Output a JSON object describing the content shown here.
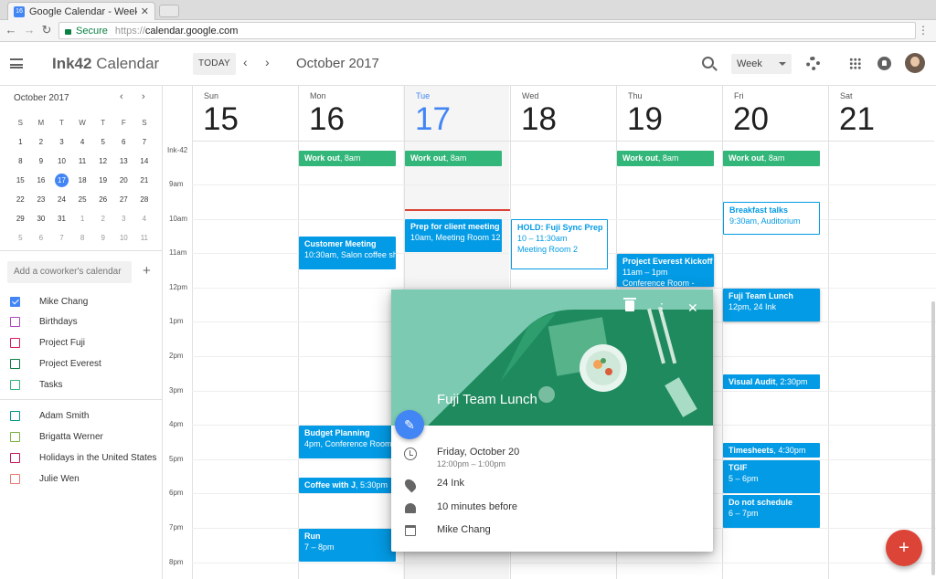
{
  "browser": {
    "tab_title": "Google Calendar - Week of Oc",
    "tab_favicon": "16",
    "secure_label": "Secure",
    "url_scheme": "https://",
    "url_host": "calendar.google.com"
  },
  "header": {
    "app_name_bold": "Ink42",
    "app_name_rest": " Calendar",
    "today_label": "TODAY",
    "month_title": "October 2017",
    "view_label": "Week"
  },
  "mini_calendar": {
    "title": "October 2017",
    "weekdays": [
      "S",
      "M",
      "T",
      "W",
      "T",
      "F",
      "S"
    ],
    "weeks": [
      [
        "1",
        "2",
        "3",
        "4",
        "5",
        "6",
        "7"
      ],
      [
        "8",
        "9",
        "10",
        "11",
        "12",
        "13",
        "14"
      ],
      [
        "15",
        "16",
        "17",
        "18",
        "19",
        "20",
        "21"
      ],
      [
        "22",
        "23",
        "24",
        "25",
        "26",
        "27",
        "28"
      ],
      [
        "29",
        "30",
        "31",
        "1",
        "2",
        "3",
        "4"
      ],
      [
        "5",
        "6",
        "7",
        "8",
        "9",
        "10",
        "11"
      ]
    ],
    "today": "17"
  },
  "sidebar": {
    "add_coworker_placeholder": "Add a coworker's calendar",
    "my_calendars": [
      {
        "name": "Mike Chang",
        "color": "#4285f4",
        "checked": true
      },
      {
        "name": "Birthdays",
        "color": "#ad47bc",
        "checked": false
      },
      {
        "name": "Project Fuji",
        "color": "#d81b60",
        "checked": false
      },
      {
        "name": "Project Everest",
        "color": "#0b8043",
        "checked": false
      },
      {
        "name": "Tasks",
        "color": "#33b679",
        "checked": false
      }
    ],
    "other_calendars": [
      {
        "name": "Adam Smith",
        "color": "#009688",
        "checked": false
      },
      {
        "name": "Brigatta Werner",
        "color": "#7cb342",
        "checked": false
      },
      {
        "name": "Holidays in the United States",
        "color": "#c2185b",
        "checked": false
      },
      {
        "name": "Julie Wen",
        "color": "#e67c73",
        "checked": false
      }
    ]
  },
  "week": {
    "days": [
      {
        "name": "Sun",
        "date": "15"
      },
      {
        "name": "Mon",
        "date": "16"
      },
      {
        "name": "Tue",
        "date": "17"
      },
      {
        "name": "Wed",
        "date": "18"
      },
      {
        "name": "Thu",
        "date": "19"
      },
      {
        "name": "Fri",
        "date": "20"
      },
      {
        "name": "Sat",
        "date": "21"
      }
    ],
    "today_index": 2,
    "allday_label": "Ink-42",
    "hours": [
      "9am",
      "10am",
      "11am",
      "12pm",
      "1pm",
      "2pm",
      "3pm",
      "4pm",
      "5pm",
      "6pm",
      "7pm",
      "8pm"
    ]
  },
  "events": [
    {
      "title": "Work out",
      "time": ", 8am",
      "day": 1
    },
    {
      "title": "Work out",
      "time": ", 8am",
      "day": 2
    },
    {
      "title": "Work out",
      "time": ", 8am",
      "day": 4
    },
    {
      "title": "Work out",
      "time": ", 8am",
      "day": 5
    },
    {
      "title": "Breakfast talks",
      "time": "9:30am, Auditorium",
      "day": 5
    },
    {
      "title": "Prep for client meeting",
      "time": "10am, Meeting Room 12",
      "day": 2
    },
    {
      "title": "HOLD: Fuji Sync Prep",
      "time": "10 – 11:30am",
      "location": "Meeting Room 2",
      "day": 3
    },
    {
      "title": "Customer Meeting",
      "time": "10:30am, Salon coffee shop",
      "day": 1
    },
    {
      "title": "Project Everest Kickoff",
      "time": "11am – 1pm",
      "location": "Conference Room -",
      "day": 4
    },
    {
      "title": "Fuji Team Lunch",
      "time": "12pm, 24 Ink",
      "day": 5
    },
    {
      "title": "Visual Audit",
      "time": ", 2:30pm",
      "day": 5
    },
    {
      "title": "Budget Planning",
      "time": "4pm, Conference Room",
      "day": 1
    },
    {
      "title": "Timesheets",
      "time": ", 4:30pm",
      "day": 5
    },
    {
      "title": "TGIF",
      "time": "5 – 6pm",
      "day": 5
    },
    {
      "title": "Coffee with J",
      "time": ", 5:30pm",
      "day": 1
    },
    {
      "title": "Do not schedule",
      "time": "6 – 7pm",
      "day": 5
    },
    {
      "title": "Run",
      "time": "7 – 8pm",
      "day": 1
    }
  ],
  "popover": {
    "title": "Fuji Team Lunch",
    "date": "Friday, October 20",
    "time": "12:00pm – 1:00pm",
    "location": "24 Ink",
    "reminder": "10 minutes before",
    "calendar": "Mike Chang"
  },
  "colors": {
    "accent": "#4285f4",
    "event_blue": "#039be5",
    "event_green": "#33b679",
    "fab_red": "#db4437"
  }
}
